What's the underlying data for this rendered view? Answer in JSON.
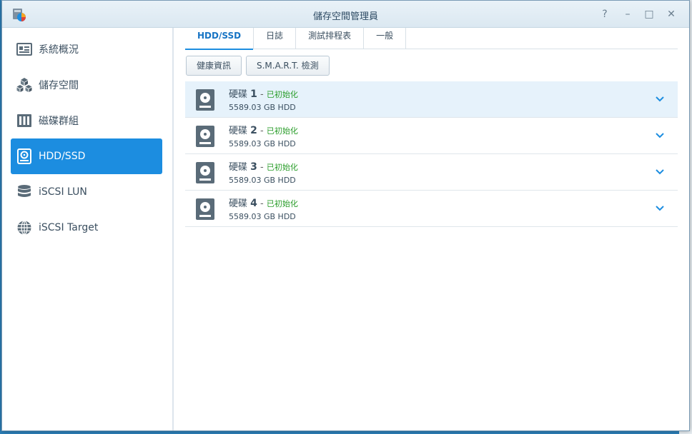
{
  "window": {
    "title": "儲存空間管理員",
    "controls": [
      "?",
      "–",
      "□",
      "✕"
    ]
  },
  "sidebar": {
    "items": [
      {
        "label": "系統概況",
        "icon": "overview-icon"
      },
      {
        "label": "儲存空間",
        "icon": "storage-cubes-icon"
      },
      {
        "label": "磁碟群組",
        "icon": "disk-group-icon"
      },
      {
        "label": "HDD/SSD",
        "icon": "hdd-icon",
        "active": true
      },
      {
        "label": "iSCSI LUN",
        "icon": "database-icon"
      },
      {
        "label": "iSCSI Target",
        "icon": "globe-icon"
      }
    ]
  },
  "tabs": [
    {
      "label": "HDD/SSD",
      "active": true
    },
    {
      "label": "日誌"
    },
    {
      "label": "測試排程表"
    },
    {
      "label": "一般"
    }
  ],
  "toolbar": {
    "health_label": "健康資訊",
    "smart_label": "S.M.A.R.T. 檢測"
  },
  "disks": [
    {
      "name": "硬碟",
      "number": "1",
      "dash": "-",
      "status": "已初始化",
      "size": "5589.03 GB HDD"
    },
    {
      "name": "硬碟",
      "number": "2",
      "dash": "-",
      "status": "已初始化",
      "size": "5589.03 GB HDD"
    },
    {
      "name": "硬碟",
      "number": "3",
      "dash": "-",
      "status": "已初始化",
      "size": "5589.03 GB HDD"
    },
    {
      "name": "硬碟",
      "number": "4",
      "dash": "-",
      "status": "已初始化",
      "size": "5589.03 GB HDD"
    }
  ],
  "colors": {
    "accent": "#1c8de0",
    "status_ok": "#2a9d2a",
    "selected_row": "#e6f2fb"
  }
}
